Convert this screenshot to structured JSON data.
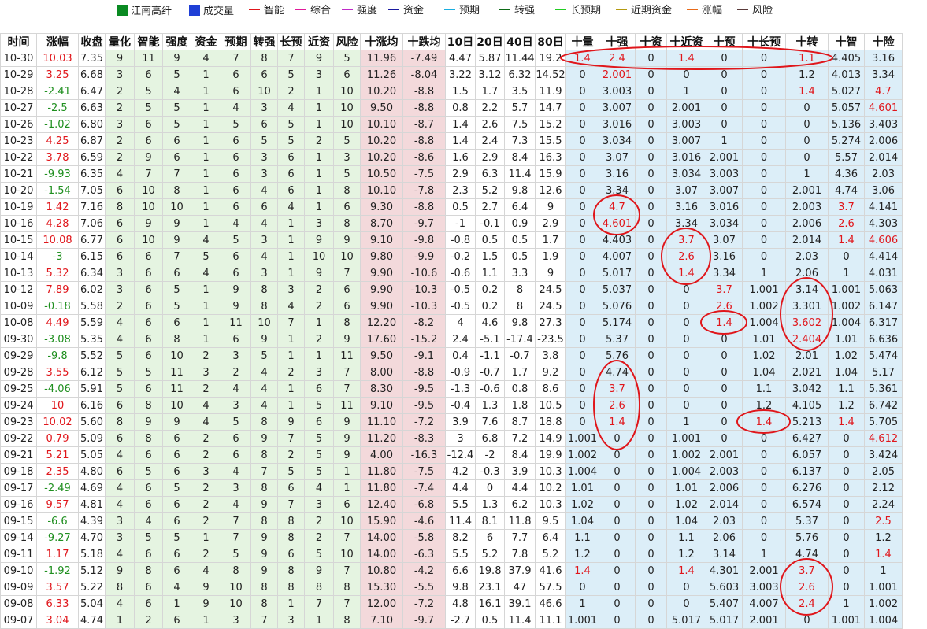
{
  "legend": [
    {
      "label": "江南高纤",
      "color": "#0a8a22",
      "kind": "box"
    },
    {
      "label": "成交量",
      "color": "#1f3fd6",
      "kind": "box"
    },
    {
      "label": "智能",
      "color": "#e0161b",
      "kind": "line"
    },
    {
      "label": "综合",
      "color": "#e01a9a",
      "kind": "line"
    },
    {
      "label": "强度",
      "color": "#c02ac8",
      "kind": "line"
    },
    {
      "label": "资金",
      "color": "#1a1aa0",
      "kind": "line"
    },
    {
      "label": "预期",
      "color": "#19aee0",
      "kind": "line"
    },
    {
      "label": "转强",
      "color": "#0c6a16",
      "kind": "line"
    },
    {
      "label": "长预期",
      "color": "#22cc22",
      "kind": "line"
    },
    {
      "label": "近期资金",
      "color": "#b49a10",
      "kind": "line"
    },
    {
      "label": "涨幅",
      "color": "#e86a1a",
      "kind": "line"
    },
    {
      "label": "风险",
      "color": "#5a3a3a",
      "kind": "line"
    }
  ],
  "chart_data": {
    "type": "table",
    "columns": [
      "时间",
      "涨幅",
      "收盘",
      "量化",
      "智能",
      "强度",
      "资金",
      "预期",
      "转强",
      "长预",
      "近资",
      "风险",
      "十涨均",
      "十跌均",
      "10日",
      "20日",
      "40日",
      "80日",
      "十量",
      "十强",
      "十资",
      "十近资",
      "十预",
      "十长预",
      "十转",
      "十智",
      "十险"
    ],
    "rows": [
      [
        "10-30",
        "10.03",
        "7.35",
        "9",
        "11",
        "9",
        "4",
        "7",
        "8",
        "7",
        "9",
        "5",
        "11.96",
        "-7.49",
        "4.47",
        "5.87",
        "11.44",
        "19.2",
        "1.4",
        "2.4",
        "0",
        "1.4",
        "0",
        "0",
        "1.1",
        "4.405",
        "3.16"
      ],
      [
        "10-29",
        "3.25",
        "6.68",
        "3",
        "6",
        "5",
        "1",
        "6",
        "6",
        "5",
        "3",
        "6",
        "11.26",
        "-8.04",
        "3.22",
        "3.12",
        "6.32",
        "14.52",
        "0",
        "2.001",
        "0",
        "0",
        "0",
        "0",
        "1.2",
        "4.013",
        "3.34"
      ],
      [
        "10-28",
        "-2.41",
        "6.47",
        "2",
        "5",
        "4",
        "1",
        "6",
        "10",
        "2",
        "1",
        "10",
        "10.20",
        "-8.8",
        "1.5",
        "1.7",
        "3.5",
        "11.9",
        "0",
        "3.003",
        "0",
        "1",
        "0",
        "0",
        "1.4",
        "5.027",
        "4.7"
      ],
      [
        "10-27",
        "-2.5",
        "6.63",
        "2",
        "5",
        "5",
        "1",
        "4",
        "3",
        "4",
        "1",
        "10",
        "9.50",
        "-8.8",
        "0.8",
        "2.2",
        "5.7",
        "14.7",
        "0",
        "3.007",
        "0",
        "2.001",
        "0",
        "0",
        "0",
        "5.057",
        "4.601"
      ],
      [
        "10-26",
        "-1.02",
        "6.80",
        "3",
        "6",
        "5",
        "1",
        "5",
        "6",
        "5",
        "1",
        "10",
        "10.10",
        "-8.7",
        "1.4",
        "2.6",
        "7.5",
        "15.2",
        "0",
        "3.016",
        "0",
        "3.003",
        "0",
        "0",
        "0",
        "5.136",
        "3.403"
      ],
      [
        "10-23",
        "4.25",
        "6.87",
        "2",
        "6",
        "6",
        "1",
        "6",
        "5",
        "5",
        "2",
        "5",
        "10.20",
        "-8.8",
        "1.4",
        "2.4",
        "7.3",
        "15.5",
        "0",
        "3.034",
        "0",
        "3.007",
        "1",
        "0",
        "0",
        "5.274",
        "2.006"
      ],
      [
        "10-22",
        "3.78",
        "6.59",
        "2",
        "9",
        "6",
        "1",
        "6",
        "3",
        "6",
        "1",
        "3",
        "10.20",
        "-8.6",
        "1.6",
        "2.9",
        "8.4",
        "16.3",
        "0",
        "3.07",
        "0",
        "3.016",
        "2.001",
        "0",
        "0",
        "5.57",
        "2.014"
      ],
      [
        "10-21",
        "-9.93",
        "6.35",
        "4",
        "7",
        "7",
        "1",
        "6",
        "3",
        "6",
        "1",
        "5",
        "10.50",
        "-7.5",
        "2.9",
        "6.3",
        "11.4",
        "15.9",
        "0",
        "3.16",
        "0",
        "3.034",
        "3.003",
        "0",
        "1",
        "4.36",
        "2.03"
      ],
      [
        "10-20",
        "-1.54",
        "7.05",
        "6",
        "10",
        "8",
        "1",
        "6",
        "4",
        "6",
        "1",
        "8",
        "10.10",
        "-7.8",
        "2.3",
        "5.2",
        "9.8",
        "12.6",
        "0",
        "3.34",
        "0",
        "3.07",
        "3.007",
        "0",
        "2.001",
        "4.74",
        "3.06"
      ],
      [
        "10-19",
        "1.42",
        "7.16",
        "8",
        "10",
        "10",
        "1",
        "6",
        "6",
        "4",
        "1",
        "6",
        "9.30",
        "-8.8",
        "0.5",
        "2.7",
        "6.4",
        "9",
        "0",
        "4.7",
        "0",
        "3.16",
        "3.016",
        "0",
        "2.003",
        "3.7",
        "4.141"
      ],
      [
        "10-16",
        "4.28",
        "7.06",
        "6",
        "9",
        "9",
        "1",
        "4",
        "4",
        "1",
        "3",
        "8",
        "8.70",
        "-9.7",
        "-1",
        "-0.1",
        "0.9",
        "2.9",
        "0",
        "4.601",
        "0",
        "3.34",
        "3.034",
        "0",
        "2.006",
        "2.6",
        "4.303"
      ],
      [
        "10-15",
        "10.08",
        "6.77",
        "6",
        "10",
        "9",
        "4",
        "5",
        "3",
        "1",
        "9",
        "9",
        "9.10",
        "-9.8",
        "-0.8",
        "0.5",
        "0.5",
        "1.7",
        "0",
        "4.403",
        "0",
        "3.7",
        "3.07",
        "0",
        "2.014",
        "1.4",
        "4.606"
      ],
      [
        "10-14",
        "-3",
        "6.15",
        "6",
        "6",
        "7",
        "5",
        "6",
        "4",
        "1",
        "10",
        "10",
        "9.80",
        "-9.9",
        "-0.2",
        "1.5",
        "0.5",
        "1.9",
        "0",
        "4.007",
        "0",
        "2.6",
        "3.16",
        "0",
        "2.03",
        "0",
        "4.414"
      ],
      [
        "10-13",
        "5.32",
        "6.34",
        "3",
        "6",
        "6",
        "4",
        "6",
        "3",
        "1",
        "9",
        "7",
        "9.90",
        "-10.6",
        "-0.6",
        "1.1",
        "3.3",
        "9",
        "0",
        "5.017",
        "0",
        "1.4",
        "3.34",
        "1",
        "2.06",
        "1",
        "4.031"
      ],
      [
        "10-12",
        "7.89",
        "6.02",
        "3",
        "6",
        "5",
        "1",
        "9",
        "8",
        "3",
        "2",
        "6",
        "9.90",
        "-10.3",
        "-0.5",
        "0.2",
        "8",
        "24.5",
        "0",
        "5.037",
        "0",
        "0",
        "3.7",
        "1.001",
        "3.14",
        "1.001",
        "5.063"
      ],
      [
        "10-09",
        "-0.18",
        "5.58",
        "2",
        "6",
        "5",
        "1",
        "9",
        "8",
        "4",
        "2",
        "6",
        "9.90",
        "-10.3",
        "-0.5",
        "0.2",
        "8",
        "24.5",
        "0",
        "5.076",
        "0",
        "0",
        "2.6",
        "1.002",
        "3.301",
        "1.002",
        "6.147"
      ],
      [
        "10-08",
        "4.49",
        "5.59",
        "4",
        "6",
        "6",
        "1",
        "11",
        "10",
        "7",
        "1",
        "8",
        "12.20",
        "-8.2",
        "4",
        "4.6",
        "9.8",
        "27.3",
        "0",
        "5.174",
        "0",
        "0",
        "1.4",
        "1.004",
        "3.602",
        "1.004",
        "6.317"
      ],
      [
        "09-30",
        "-3.08",
        "5.35",
        "4",
        "6",
        "8",
        "1",
        "6",
        "9",
        "1",
        "2",
        "9",
        "17.60",
        "-15.2",
        "2.4",
        "-5.1",
        "-17.4",
        "-23.5",
        "0",
        "5.37",
        "0",
        "0",
        "0",
        "1.01",
        "2.404",
        "1.01",
        "6.636"
      ],
      [
        "09-29",
        "-9.8",
        "5.52",
        "5",
        "6",
        "10",
        "2",
        "3",
        "5",
        "1",
        "1",
        "11",
        "9.50",
        "-9.1",
        "0.4",
        "-1.1",
        "-0.7",
        "3.8",
        "0",
        "5.76",
        "0",
        "0",
        "0",
        "1.02",
        "2.01",
        "1.02",
        "5.474"
      ],
      [
        "09-28",
        "3.55",
        "6.12",
        "5",
        "5",
        "11",
        "3",
        "2",
        "4",
        "2",
        "3",
        "7",
        "8.00",
        "-8.8",
        "-0.9",
        "-0.7",
        "1.7",
        "9.2",
        "0",
        "4.74",
        "0",
        "0",
        "0",
        "1.04",
        "2.021",
        "1.04",
        "5.17"
      ],
      [
        "09-25",
        "-4.06",
        "5.91",
        "5",
        "6",
        "11",
        "2",
        "4",
        "4",
        "1",
        "6",
        "7",
        "8.30",
        "-9.5",
        "-1.3",
        "-0.6",
        "0.8",
        "8.6",
        "0",
        "3.7",
        "0",
        "0",
        "0",
        "1.1",
        "3.042",
        "1.1",
        "5.361"
      ],
      [
        "09-24",
        "10",
        "6.16",
        "6",
        "8",
        "10",
        "4",
        "3",
        "4",
        "1",
        "5",
        "11",
        "9.10",
        "-9.5",
        "-0.4",
        "1.3",
        "1.8",
        "10.5",
        "0",
        "2.6",
        "0",
        "0",
        "0",
        "1.2",
        "4.105",
        "1.2",
        "6.742"
      ],
      [
        "09-23",
        "10.02",
        "5.60",
        "8",
        "9",
        "9",
        "4",
        "5",
        "8",
        "9",
        "6",
        "9",
        "11.10",
        "-7.2",
        "3.9",
        "7.6",
        "8.7",
        "18.8",
        "0",
        "1.4",
        "0",
        "1",
        "0",
        "1.4",
        "5.213",
        "1.4",
        "5.705"
      ],
      [
        "09-22",
        "0.79",
        "5.09",
        "6",
        "8",
        "6",
        "2",
        "6",
        "9",
        "7",
        "5",
        "9",
        "11.20",
        "-8.3",
        "3",
        "6.8",
        "7.2",
        "14.9",
        "1.001",
        "0",
        "0",
        "1.001",
        "0",
        "0",
        "6.427",
        "0",
        "4.612"
      ],
      [
        "09-21",
        "5.21",
        "5.05",
        "4",
        "6",
        "6",
        "2",
        "6",
        "8",
        "2",
        "5",
        "9",
        "4.00",
        "-16.3",
        "-12.4",
        "-2",
        "8.4",
        "19.9",
        "1.002",
        "0",
        "0",
        "1.002",
        "2.001",
        "0",
        "6.057",
        "0",
        "3.424"
      ],
      [
        "09-18",
        "2.35",
        "4.80",
        "6",
        "5",
        "6",
        "3",
        "4",
        "7",
        "5",
        "5",
        "1",
        "11.80",
        "-7.5",
        "4.2",
        "-0.3",
        "3.9",
        "10.3",
        "1.004",
        "0",
        "0",
        "1.004",
        "2.003",
        "0",
        "6.137",
        "0",
        "2.05"
      ],
      [
        "09-17",
        "-2.49",
        "4.69",
        "4",
        "6",
        "5",
        "2",
        "3",
        "8",
        "6",
        "4",
        "1",
        "11.80",
        "-7.4",
        "4.4",
        "0",
        "4.4",
        "10.2",
        "1.01",
        "0",
        "0",
        "1.01",
        "2.006",
        "0",
        "6.276",
        "0",
        "2.12"
      ],
      [
        "09-16",
        "9.57",
        "4.81",
        "4",
        "6",
        "6",
        "2",
        "4",
        "9",
        "7",
        "3",
        "6",
        "12.40",
        "-6.8",
        "5.5",
        "1.3",
        "6.2",
        "10.3",
        "1.02",
        "0",
        "0",
        "1.02",
        "2.014",
        "0",
        "6.574",
        "0",
        "2.24"
      ],
      [
        "09-15",
        "-6.6",
        "4.39",
        "3",
        "4",
        "6",
        "2",
        "7",
        "8",
        "8",
        "2",
        "10",
        "15.90",
        "-4.6",
        "11.4",
        "8.1",
        "11.8",
        "9.5",
        "1.04",
        "0",
        "0",
        "1.04",
        "2.03",
        "0",
        "5.37",
        "0",
        "2.5"
      ],
      [
        "09-14",
        "-9.27",
        "4.70",
        "3",
        "5",
        "5",
        "1",
        "7",
        "9",
        "8",
        "2",
        "7",
        "14.00",
        "-5.8",
        "8.2",
        "6",
        "7.7",
        "6.4",
        "1.1",
        "0",
        "0",
        "1.1",
        "2.06",
        "0",
        "5.76",
        "0",
        "1.2"
      ],
      [
        "09-11",
        "1.17",
        "5.18",
        "4",
        "6",
        "6",
        "2",
        "5",
        "9",
        "6",
        "5",
        "10",
        "14.00",
        "-6.3",
        "5.5",
        "5.2",
        "7.8",
        "5.2",
        "1.2",
        "0",
        "0",
        "1.2",
        "3.14",
        "1",
        "4.74",
        "0",
        "1.4"
      ],
      [
        "09-10",
        "-1.92",
        "5.12",
        "9",
        "8",
        "6",
        "4",
        "8",
        "9",
        "8",
        "9",
        "7",
        "10.80",
        "-4.2",
        "6.6",
        "19.8",
        "37.9",
        "41.6",
        "1.4",
        "0",
        "0",
        "1.4",
        "4.301",
        "2.001",
        "3.7",
        "0",
        "1"
      ],
      [
        "09-09",
        "3.57",
        "5.22",
        "8",
        "6",
        "4",
        "9",
        "10",
        "8",
        "8",
        "8",
        "8",
        "15.30",
        "-5.5",
        "9.8",
        "23.1",
        "47",
        "57.5",
        "0",
        "0",
        "0",
        "0",
        "5.603",
        "3.003",
        "2.6",
        "0",
        "1.001"
      ],
      [
        "09-08",
        "6.33",
        "5.04",
        "4",
        "6",
        "1",
        "9",
        "10",
        "8",
        "1",
        "7",
        "7",
        "12.00",
        "-7.2",
        "4.8",
        "16.1",
        "39.1",
        "46.6",
        "1",
        "0",
        "0",
        "0",
        "5.407",
        "4.007",
        "2.4",
        "1",
        "1.002"
      ],
      [
        "09-07",
        "3.04",
        "4.74",
        "1",
        "2",
        "6",
        "1",
        "3",
        "7",
        "3",
        "1",
        "8",
        "7.10",
        "-9.7",
        "-2.7",
        "0.5",
        "11.4",
        "11.1",
        "1.001",
        "0",
        "0",
        "5.017",
        "5.017",
        "2.001",
        "0",
        "1.001",
        "1.004"
      ]
    ],
    "highlights": [
      [
        0,
        18
      ],
      [
        0,
        19
      ],
      [
        0,
        21
      ],
      [
        0,
        24
      ],
      [
        1,
        19
      ],
      [
        2,
        24
      ],
      [
        2,
        26
      ],
      [
        3,
        26
      ],
      [
        9,
        19
      ],
      [
        9,
        25
      ],
      [
        10,
        19
      ],
      [
        10,
        25
      ],
      [
        11,
        21
      ],
      [
        11,
        25
      ],
      [
        11,
        26
      ],
      [
        12,
        21
      ],
      [
        13,
        21
      ],
      [
        14,
        22
      ],
      [
        15,
        22
      ],
      [
        16,
        22
      ],
      [
        16,
        24
      ],
      [
        17,
        24
      ],
      [
        20,
        19
      ],
      [
        21,
        19
      ],
      [
        22,
        19
      ],
      [
        22,
        23
      ],
      [
        22,
        25
      ],
      [
        23,
        26
      ],
      [
        28,
        26
      ],
      [
        30,
        26
      ],
      [
        31,
        18
      ],
      [
        31,
        21
      ],
      [
        31,
        24
      ],
      [
        32,
        24
      ],
      [
        33,
        24
      ]
    ],
    "ellipses": [
      {
        "rows": [
          0,
          0
        ],
        "cols": [
          18,
          24
        ]
      },
      {
        "rows": [
          9,
          10
        ],
        "cols": [
          19,
          19
        ]
      },
      {
        "rows": [
          11,
          13
        ],
        "cols": [
          21,
          21
        ]
      },
      {
        "rows": [
          14,
          17
        ],
        "cols": [
          24,
          24
        ]
      },
      {
        "rows": [
          16,
          16
        ],
        "cols": [
          22,
          22
        ]
      },
      {
        "rows": [
          19,
          23
        ],
        "cols": [
          19,
          19
        ]
      },
      {
        "rows": [
          22,
          22
        ],
        "cols": [
          23,
          23
        ]
      },
      {
        "rows": [
          31,
          33
        ],
        "cols": [
          24,
          24
        ]
      }
    ]
  }
}
